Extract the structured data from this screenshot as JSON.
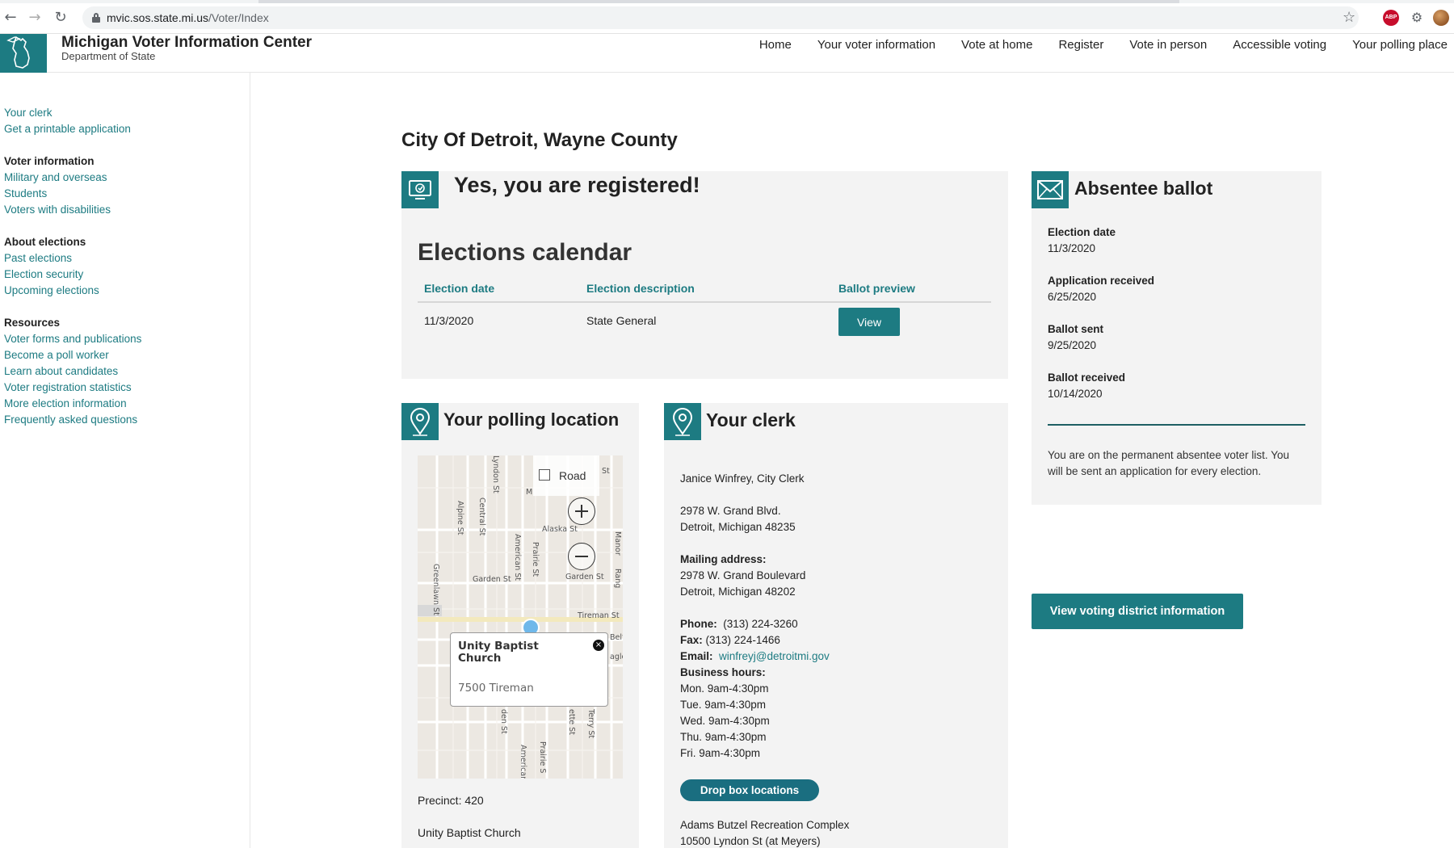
{
  "browser": {
    "url_host": "mvic.sos.state.mi.us",
    "url_path": "/Voter/Index",
    "abp_label": "ABP"
  },
  "header": {
    "title": "Michigan Voter Information Center",
    "subtitle": "Department of State",
    "nav": [
      "Home",
      "Your voter information",
      "Vote at home",
      "Register",
      "Vote in person",
      "Accessible voting",
      "Your polling place"
    ]
  },
  "sidebar": {
    "top_links": [
      "Your clerk",
      "Get a printable application"
    ],
    "groups": [
      {
        "heading": "Voter information",
        "links": [
          "Military and overseas",
          "Students",
          "Voters with disabilities"
        ]
      },
      {
        "heading": "About elections",
        "links": [
          "Past elections",
          "Election security",
          "Upcoming elections"
        ]
      },
      {
        "heading": "Resources",
        "links": [
          "Voter forms and publications",
          "Become a poll worker",
          "Learn about candidates",
          "Voter registration statistics",
          "More election information",
          "Frequently asked questions"
        ]
      }
    ]
  },
  "main": {
    "title": "City Of Detroit, Wayne County",
    "registration": {
      "heading": "Yes, you are registered!",
      "calendar_title": "Elections calendar",
      "columns": [
        "Election date",
        "Election description",
        "Ballot preview"
      ],
      "rows": [
        {
          "date": "11/3/2020",
          "description": "State General",
          "action": "View"
        }
      ]
    },
    "absentee": {
      "heading": "Absentee ballot",
      "fields": [
        {
          "label": "Election date",
          "value": "11/3/2020"
        },
        {
          "label": "Application received",
          "value": "6/25/2020"
        },
        {
          "label": "Ballot sent",
          "value": "9/25/2020"
        },
        {
          "label": "Ballot received",
          "value": "10/14/2020"
        }
      ],
      "note": "You are on the permanent absentee voter list. You will be sent an application for every election."
    },
    "district_button": "View voting district information",
    "polling": {
      "heading": "Your polling location",
      "map": {
        "style_button": "Road",
        "popup_name": "Unity Baptist Church",
        "popup_address": "7500 Tireman",
        "streets": [
          "Alaska St",
          "Garden St",
          "Garden St",
          "Tireman St",
          "Alpine St",
          "Central St",
          "American St",
          "Prairie St",
          "Greenlawn St",
          "Lyndon St",
          "Belf",
          "agle",
          "Manor",
          "Rang",
          "den St",
          "Prairie S",
          "American",
          "ette St",
          "Terry St",
          "M",
          "St"
        ]
      },
      "precinct": "Precinct: 420",
      "location_name": "Unity Baptist Church"
    },
    "clerk": {
      "heading": "Your clerk",
      "name": "Janice Winfrey, City Clerk",
      "address_line1": "2978 W. Grand Blvd.",
      "address_line2": "Detroit, Michigan 48235",
      "mailing_label": "Mailing address:",
      "mailing_line1": "2978 W. Grand Boulevard",
      "mailing_line2": "Detroit, Michigan 48202",
      "phone_label": "Phone:",
      "phone": "(313) 224-3260",
      "fax_label": "Fax:",
      "fax": "(313) 224-1466",
      "email_label": "Email:",
      "email": "winfreyj@detroitmi.gov",
      "hours_label": "Business hours:",
      "hours": [
        "Mon. 9am-4:30pm",
        "Tue. 9am-4:30pm",
        "Wed. 9am-4:30pm",
        "Thu. 9am-4:30pm",
        "Fri. 9am-4:30pm"
      ],
      "dropbox_button": "Drop box locations",
      "dropbox_line1": "Adams Butzel Recreation Complex",
      "dropbox_line2": "10500 Lyndon St (at Meyers)"
    }
  },
  "colors": {
    "teal": "#1d7b82",
    "panel": "#f3f3f3"
  }
}
